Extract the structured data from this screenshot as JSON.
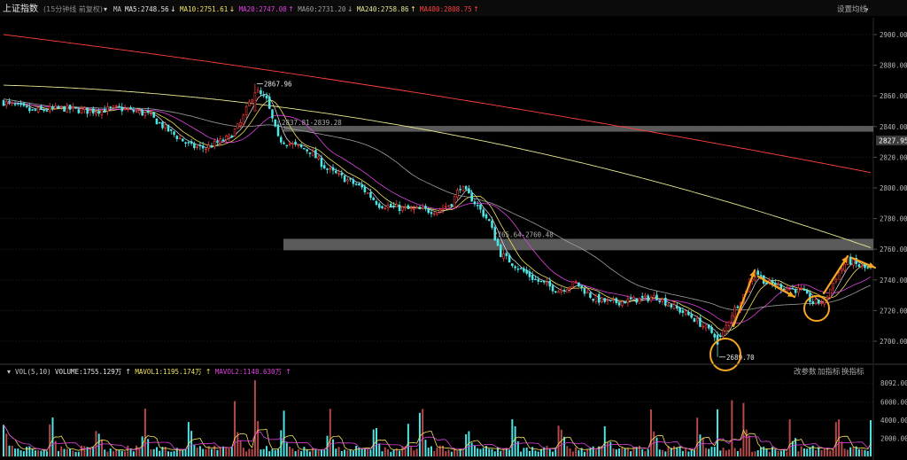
{
  "colors": {
    "background": "#000000",
    "grid": "#1e1e1e",
    "up": "#ff3c3c",
    "up_fill": "#000000",
    "down": "#4fe6e6",
    "header_bg": "#0b0b0b",
    "annotation": "#f5a623",
    "ma5": "#e8e8e8",
    "ma10": "#f2e35b",
    "ma20": "#e040e0",
    "ma60": "#9f9f9f",
    "ma240": "#e8e890",
    "ma480": "#ff4040",
    "zone": "#6a6a6a",
    "price_tag_bg": "#3b3b3b"
  },
  "header": {
    "title": "上证指数",
    "subtitle": "(15分钟线 前复权)",
    "ma_label": "MA",
    "items": [
      {
        "label": "MA5:2748.56",
        "color": "#e8e8e8"
      },
      {
        "label": "MA10:2751.61",
        "color": "#f2e35b"
      },
      {
        "label": "MA20:2747.08",
        "color": "#e040e0"
      },
      {
        "label": "MA60:2731.20",
        "color": "#9f9f9f"
      },
      {
        "label": "MA240:2758.86",
        "color": "#e8e890"
      },
      {
        "label": "MA480:2808.75",
        "color": "#ff4040"
      }
    ],
    "settings": "设置均线"
  },
  "vol_header": {
    "label": "VOL(5,10)",
    "items": [
      {
        "label": "VOLUME:1755.129万",
        "color": "#e8e8e8"
      },
      {
        "label": "MAVOL1:1195.174万",
        "color": "#f2e35b"
      },
      {
        "label": "MAVOL2:1148.630万",
        "color": "#e040e0"
      }
    ],
    "buttons": [
      "改参数",
      "加指标",
      "换指标"
    ]
  },
  "chart_data": [
    {
      "type": "candlestick",
      "name": "上证指数",
      "ylim": [
        2685,
        2910
      ],
      "yticks": [
        "2900.00",
        "2880.00",
        "2860.00",
        "2840.00",
        "2820.00",
        "2800.00",
        "2780.00",
        "2760.00",
        "2740.00",
        "2720.00",
        "2700.00"
      ],
      "last_price": "2827.95",
      "anchors": [
        [
          0,
          2856
        ],
        [
          10,
          2850
        ],
        [
          20,
          2852
        ],
        [
          30,
          2850
        ],
        [
          40,
          2852
        ],
        [
          50,
          2848
        ],
        [
          58,
          2836
        ],
        [
          65,
          2827
        ],
        [
          70,
          2826
        ],
        [
          78,
          2833
        ],
        [
          82,
          2842
        ],
        [
          87,
          2864
        ],
        [
          91,
          2857
        ],
        [
          95,
          2832
        ],
        [
          100,
          2828
        ],
        [
          106,
          2824
        ],
        [
          112,
          2812
        ],
        [
          118,
          2806
        ],
        [
          124,
          2800
        ],
        [
          130,
          2789
        ],
        [
          140,
          2786
        ],
        [
          150,
          2785
        ],
        [
          155,
          2790
        ],
        [
          158,
          2801
        ],
        [
          162,
          2793
        ],
        [
          168,
          2778
        ],
        [
          172,
          2757
        ],
        [
          178,
          2748
        ],
        [
          184,
          2740
        ],
        [
          192,
          2733
        ],
        [
          198,
          2738
        ],
        [
          204,
          2728
        ],
        [
          210,
          2725
        ],
        [
          218,
          2727
        ],
        [
          226,
          2729
        ],
        [
          232,
          2722
        ],
        [
          238,
          2716
        ],
        [
          244,
          2707
        ],
        [
          248,
          2702
        ],
        [
          252,
          2718
        ],
        [
          256,
          2730
        ],
        [
          260,
          2746
        ],
        [
          264,
          2738
        ],
        [
          270,
          2735
        ],
        [
          276,
          2733
        ],
        [
          280,
          2725
        ],
        [
          284,
          2726
        ],
        [
          288,
          2742
        ],
        [
          292,
          2753
        ],
        [
          297,
          2748
        ],
        [
          300,
          2747
        ]
      ],
      "annotations": [
        {
          "label": "2867.96"
        },
        {
          "label": "2837.81-2839.28"
        },
        {
          "label": "2765.64-2760.48"
        },
        {
          "label": "2689.70"
        }
      ],
      "zones": [
        [
          2837.81,
          2839.28
        ],
        [
          2760.48,
          2765.64
        ]
      ]
    },
    {
      "type": "bar",
      "name": "VOLUME",
      "yticks": [
        "8092.00",
        "6000.00",
        "4000.00",
        "2000.00"
      ],
      "ylim": [
        0,
        8800
      ],
      "series": [
        {
          "name": "VOLUME"
        },
        {
          "name": "MAVOL1"
        },
        {
          "name": "MAVOL2"
        }
      ]
    }
  ]
}
